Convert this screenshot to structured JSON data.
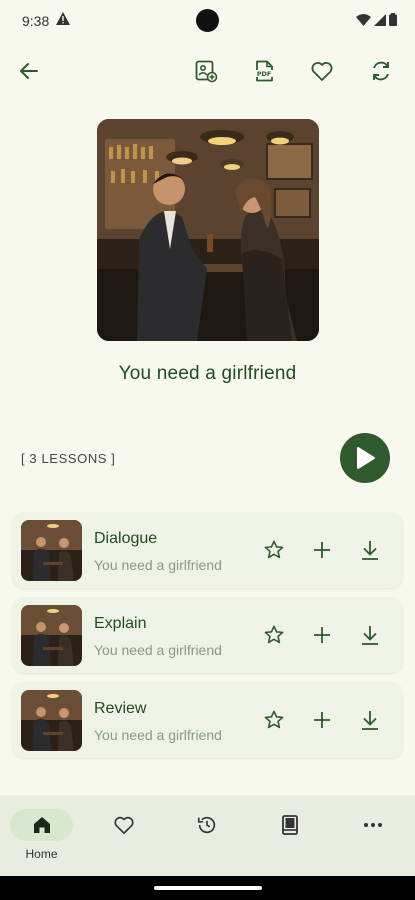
{
  "status_bar": {
    "time": "9:38"
  },
  "colors": {
    "accent": "#2f5a2e",
    "background": "#f7f9ef",
    "card": "#eff2e7",
    "nav": "#e9ede1"
  },
  "header": {
    "icons": [
      "back-arrow-icon",
      "add-to-list-icon",
      "pdf-icon",
      "heart-icon",
      "refresh-icon"
    ]
  },
  "course": {
    "title": "You need a girlfriend",
    "lessons_label": "[ 3 LESSONS ]"
  },
  "lessons": [
    {
      "name": "Dialogue",
      "subtitle": "You need a girlfriend"
    },
    {
      "name": "Explain",
      "subtitle": "You need a girlfriend"
    },
    {
      "name": "Review",
      "subtitle": "You need a girlfriend"
    }
  ],
  "bottom_nav": {
    "items": [
      {
        "label": "Home",
        "icon": "home-icon",
        "active": true
      },
      {
        "label": "",
        "icon": "heart-icon"
      },
      {
        "label": "",
        "icon": "history-icon"
      },
      {
        "label": "",
        "icon": "book-icon"
      },
      {
        "label": "",
        "icon": "more-icon"
      }
    ]
  }
}
